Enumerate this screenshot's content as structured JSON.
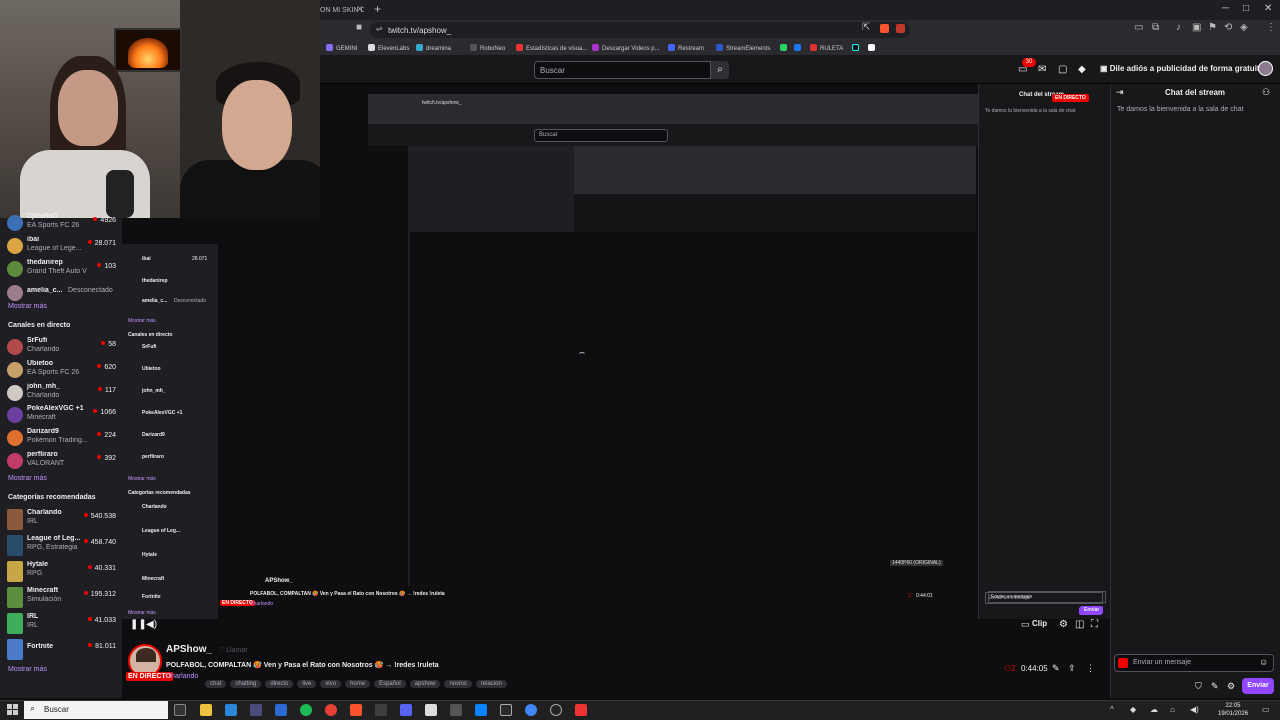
{
  "browser": {
    "tab_title": "ON MI SKIN D",
    "url": "twitch.tv/apshow_",
    "bookmarks": [
      "GEMINI",
      "ElevenLabs",
      "dreamina",
      "RoboNeo",
      "Estadísticas de visua...",
      "Descargar Videos p...",
      "Restream",
      "StreamElements",
      "RULETA"
    ]
  },
  "nav": {
    "search_placeholder": "Buscar",
    "notif_count": "30",
    "prime_text": "Dile adiós a publicidad de forma gratuita"
  },
  "sidebar": {
    "followed": [
      {
        "name": "DjMaRiiO",
        "game": "EA Sports FC 26",
        "viewers": "4926",
        "color": "#3b6fb6"
      },
      {
        "name": "ibai",
        "game": "League of Lege...",
        "viewers": "28.071",
        "color": "#d9a441"
      },
      {
        "name": "thedanirep",
        "game": "Grand Theft Auto V",
        "viewers": "103",
        "color": "#5d8a3c"
      },
      {
        "name": "amelia_c...",
        "game": "",
        "viewers": "",
        "offline": "Desconectado",
        "color": "#9b7d8c"
      }
    ],
    "more1": "Mostrar más",
    "live_header": "Canales en directo",
    "live": [
      {
        "name": "SrFufi",
        "game": "Charlando",
        "viewers": "58",
        "color": "#b34a4a"
      },
      {
        "name": "Ubietoo",
        "game": "EA Sports FC 26",
        "viewers": "620",
        "color": "#c7a068"
      },
      {
        "name": "john_mh_",
        "game": "Charlando",
        "viewers": "117",
        "color": "#d0c9c4"
      },
      {
        "name": "PokeAlexVGC +1",
        "game": "Minecraft",
        "viewers": "1066",
        "color": "#6a3fa0"
      },
      {
        "name": "Darizard9",
        "game": "Pokémon Trading...",
        "viewers": "224",
        "color": "#e07030"
      },
      {
        "name": "perfliraro",
        "game": "VALORANT",
        "viewers": "392",
        "color": "#c23c6a"
      }
    ],
    "more2": "Mostrar más",
    "cat_header": "Categorías recomendadas",
    "categories": [
      {
        "name": "Charlando",
        "tag": "IRL",
        "viewers": "540.538",
        "color": "#8b5a3c"
      },
      {
        "name": "League of Leg...",
        "tag": "RPG, Estrategia",
        "viewers": "458.740",
        "color": "#2a4c6b"
      },
      {
        "name": "Hytale",
        "tag": "RPG",
        "viewers": "40.331",
        "color": "#c7a648"
      },
      {
        "name": "Minecraft",
        "tag": "Simulación",
        "viewers": "195.312",
        "color": "#5c8f3d"
      },
      {
        "name": "IRL",
        "tag": "IRL",
        "viewers": "41.033",
        "color": "#3fae5a"
      },
      {
        "name": "Fortnite",
        "tag": "",
        "viewers": "81.011",
        "color": "#4a7ac9"
      }
    ],
    "more3": "Mostrar más"
  },
  "nested": {
    "chat_title": "Chat del stream",
    "welcome": "Te damos la bienvenida a la sala de chat",
    "live_badge": "EN DIRECTO",
    "input_placeholder": "Enviar un mensaje",
    "send": "Enviar",
    "quality": "1440P60 (ORIGINAL)",
    "pause": "Pausar",
    "follow": "Llamar",
    "uptime": "0:44:01",
    "viewers": "2"
  },
  "player": {
    "clip_label": "Clip"
  },
  "stream": {
    "streamer": "APShow_",
    "follow": "Llamar",
    "title": "POLFABOL, COMPALTAN 🥵 Ven y Pasa el Rato con Nosotros 🥵 → !redes !ruleta",
    "live": "EN DIRECTO",
    "category": "Charlando",
    "tags": [
      "chat",
      "chatting",
      "directo",
      "live",
      "vivo",
      "home",
      "Español",
      "apshow",
      "novios",
      "relacion"
    ],
    "viewers": "2",
    "uptime": "0:44:05"
  },
  "chat": {
    "title": "Chat del stream",
    "welcome": "Te damos la bienvenida a la sala de chat",
    "input_placeholder": "Enviar un mensaje",
    "send": "Enviar"
  },
  "taskbar": {
    "search": "Buscar",
    "time": "22:05",
    "date": "19/01/2026"
  },
  "colors": {
    "accent": "#9147ff",
    "live": "#eb0400",
    "link": "#bf94ff"
  }
}
